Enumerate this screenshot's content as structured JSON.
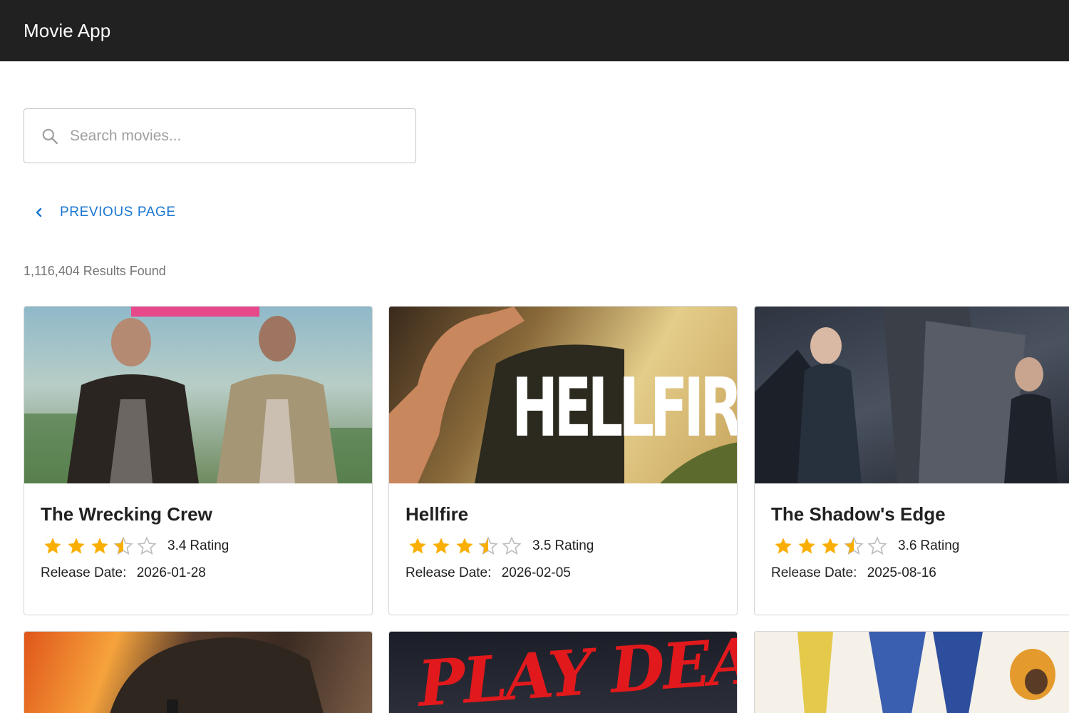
{
  "app": {
    "title": "Movie App"
  },
  "search": {
    "placeholder": "Search movies..."
  },
  "pagination": {
    "previous_label": "Previous Page"
  },
  "results": {
    "count_text": "1,116,404 Results Found"
  },
  "movies": [
    {
      "title": "The Wrecking Crew",
      "rating": 3.4,
      "rating_value": "3.4",
      "rating_word": "Rating",
      "release_label": "Release Date:",
      "release_date": "2026-01-28",
      "poster_icon": "poster-image"
    },
    {
      "title": "Hellfire",
      "rating": 3.5,
      "rating_value": "3.5",
      "rating_word": "Rating",
      "release_label": "Release Date:",
      "release_date": "2026-02-05",
      "poster_text": "HELLFIRE",
      "poster_icon": "poster-image"
    },
    {
      "title": "The Shadow's Edge",
      "rating": 3.6,
      "rating_value": "3.6",
      "rating_word": "Rating",
      "release_label": "Release Date:",
      "release_date": "2025-08-16",
      "poster_icon": "poster-image"
    },
    {
      "poster_icon": "poster-image"
    },
    {
      "poster_text": "PLAY DEAD",
      "poster_icon": "poster-image"
    },
    {
      "poster_icon": "poster-image"
    }
  ],
  "colors": {
    "appbar": "#212121",
    "accent": "#1976d2",
    "star_filled": "#faaf00",
    "star_empty": "#bdbdbd"
  }
}
